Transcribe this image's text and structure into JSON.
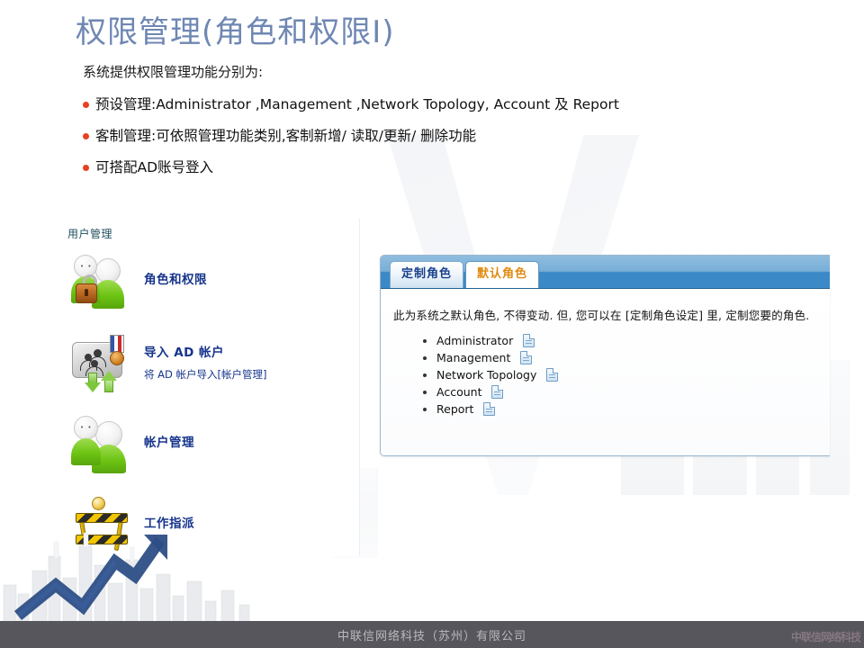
{
  "slide": {
    "title": "权限管理(角色和权限I)",
    "title_color": "#6f87b3",
    "accent_bullet_color": "#e8401f",
    "lead": "系统提供权限管理功能分别为:",
    "bullets": [
      "预设管理:Administrator ,Management ,Network Topology, Account 及 Report",
      "客制管理:可依照管理功能类别,客制新增/ 读取/更新/ 删除功能",
      "可搭配AD账号登入"
    ]
  },
  "left_panel": {
    "section_title": "用户管理",
    "section_title_color": "#1f4e5f",
    "items": [
      {
        "label": "角色和权限",
        "sub": "",
        "icon": "users-lock-icon"
      },
      {
        "label": "导入 AD 帐户",
        "sub": "将 AD 帐户导入[帐户管理]",
        "icon": "import-ad-icon"
      },
      {
        "label": "帐户管理",
        "sub": "",
        "icon": "users-icon"
      },
      {
        "label": "工作指派",
        "sub": "",
        "icon": "work-barrier-icon"
      }
    ]
  },
  "right_panel": {
    "tabs": [
      {
        "label": "定制角色",
        "active": false,
        "color": "#18418c"
      },
      {
        "label": "默认角色",
        "active": true,
        "color": "#e08a10"
      }
    ],
    "note": "此为系统之默认角色, 不得变动. 但, 您可以在 [定制角色设定] 里, 定制您要的角色.",
    "roles": [
      "Administrator",
      "Management",
      "Network Topology",
      "Account",
      "Report"
    ],
    "role_icon": "document-icon",
    "header_color": "#3b89c6"
  },
  "footer": {
    "company": "中联信网络科技（苏州）有限公司",
    "bar_color": "#56565c",
    "watermark": "中联信网络科技"
  }
}
